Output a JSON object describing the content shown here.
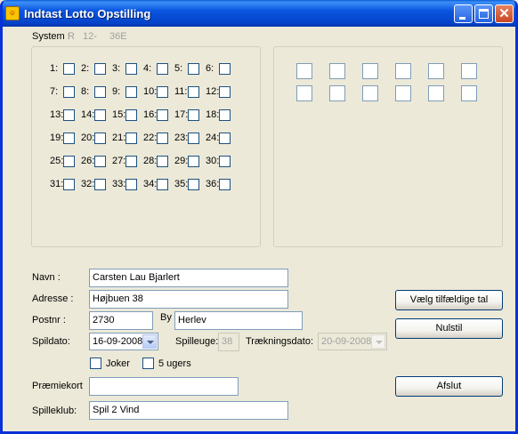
{
  "window": {
    "title": "Indtast Lotto Opstilling",
    "icon": "lotto-app-icon"
  },
  "system": {
    "label": "System :",
    "type": "R",
    "count": "12-",
    "total": "36E"
  },
  "numbers": [
    "1:",
    "2:",
    "3:",
    "4:",
    "5:",
    "6:",
    "7:",
    "8:",
    "9:",
    "10:",
    "11:",
    "12:",
    "13:",
    "14:",
    "15:",
    "16:",
    "17:",
    "18:",
    "19:",
    "20:",
    "21:",
    "22:",
    "23:",
    "24:",
    "25:",
    "26:",
    "27:",
    "28:",
    "29:",
    "30:",
    "31:",
    "32:",
    "33:",
    "34:",
    "35:",
    "36:"
  ],
  "selected_numbers_slots": 12,
  "form": {
    "navn_label": "Navn :",
    "navn_value": "Carsten Lau Bjarlert",
    "adresse_label": "Adresse :",
    "adresse_value": "Højbuen 38",
    "postnr_label": "Postnr :",
    "postnr_value": "2730",
    "by_label": "By",
    "by_value": "Herlev",
    "spildato_label": "Spildato:",
    "spildato_value": "16-09-2008",
    "spilleuge_label": "Spilleuge:",
    "spilleuge_value": "38",
    "traekningsdato_label": "Trækningsdato:",
    "traekningsdato_value": "20-09-2008",
    "joker_label": "Joker",
    "fem_uger_label": "5 ugers",
    "praemiekort_label": "Præmiekort",
    "praemiekort_value": "",
    "spilleklub_label": "Spilleklub:",
    "spilleklub_value": "Spil 2 Vind"
  },
  "buttons": {
    "random": "Vælg tilfældige tal",
    "reset": "Nulstil",
    "close": "Afslut"
  }
}
